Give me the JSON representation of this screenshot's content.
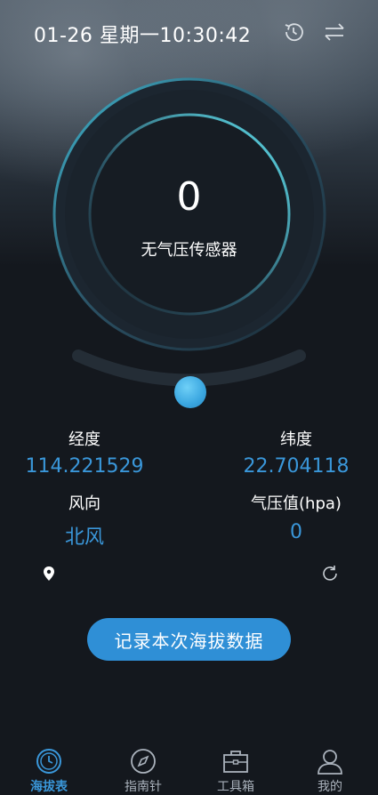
{
  "status": {
    "date": "01-26",
    "weekday": "星期一",
    "time": "10:30:42",
    "icons": [
      "history-icon",
      "swap-icon"
    ]
  },
  "gauge": {
    "value": "0",
    "label": "无气压传感器"
  },
  "fields": {
    "longitude": {
      "label": "经度",
      "value": "114.221529"
    },
    "latitude": {
      "label": "纬度",
      "value": "22.704118"
    },
    "wind": {
      "label": "风向",
      "value": "北风"
    },
    "pressure": {
      "label": "气压值(hpa)",
      "value": "0"
    }
  },
  "actions": {
    "record_label": "记录本次海拔数据"
  },
  "tabs": [
    {
      "label": "海拔表",
      "icon": "clock-icon",
      "active": true
    },
    {
      "label": "指南针",
      "icon": "compass-icon",
      "active": false
    },
    {
      "label": "工具箱",
      "icon": "toolbox-icon",
      "active": false
    },
    {
      "label": "我的",
      "icon": "person-icon",
      "active": false
    }
  ],
  "colors": {
    "accent": "#3a97da",
    "button": "#2f8fd6",
    "ring": "#5fd6e8",
    "background": "#14181e"
  }
}
